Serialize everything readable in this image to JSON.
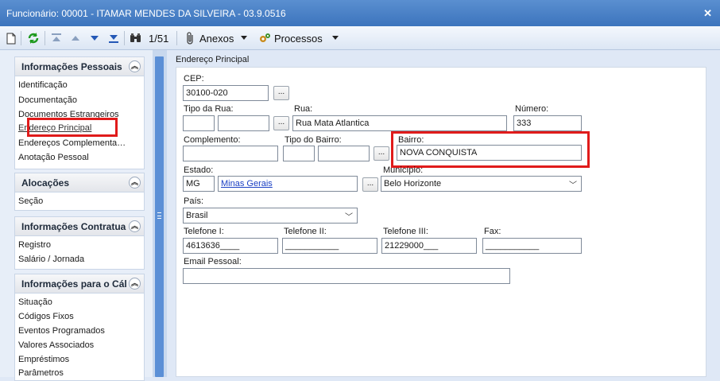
{
  "window": {
    "title": "Funcionário: 00001 - ITAMAR MENDES DA SILVEIRA - 03.9.0516",
    "close_glyph": "✕"
  },
  "toolbar": {
    "record_position": "1/51",
    "anexos_label": "Anexos",
    "processos_label": "Processos"
  },
  "sidebar": {
    "groups": [
      {
        "title": "Informações Pessoais",
        "items": [
          "Identificação",
          "Documentação",
          "Documentos Estrangeiros",
          "Endereço Principal",
          "Endereços Complementa…",
          "Anotação Pessoal"
        ]
      },
      {
        "title": "Alocações",
        "items": [
          "Seção"
        ]
      },
      {
        "title": "Informações Contratua",
        "items": [
          "Registro",
          "Salário / Jornada"
        ]
      },
      {
        "title": "Informações para o Cál",
        "items": [
          "Situação",
          "Códigos Fixos",
          "Eventos Programados",
          "Valores Associados",
          "Empréstimos",
          "Parâmetros"
        ]
      }
    ],
    "collapse_glyph": "︽"
  },
  "form": {
    "section_title": "Endereço Principal",
    "cep": {
      "label": "CEP:",
      "value": "30100-020"
    },
    "tipo_rua": {
      "label": "Tipo da Rua:",
      "code": "",
      "name": ""
    },
    "rua": {
      "label": "Rua:",
      "value": "Rua Mata Atlantica"
    },
    "numero": {
      "label": "Número:",
      "value": "333"
    },
    "complemento": {
      "label": "Complemento:",
      "value": ""
    },
    "tipo_bairro": {
      "label": "Tipo do Bairro:",
      "code": "",
      "name": ""
    },
    "bairro": {
      "label": "Bairro:",
      "value": "NOVA CONQUISTA"
    },
    "estado": {
      "label": "Estado:",
      "code": "MG",
      "name": "Minas Gerais"
    },
    "municipio": {
      "label": "Município:",
      "value": "Belo Horizonte"
    },
    "pais": {
      "label": "País:",
      "value": "Brasil"
    },
    "telefone1": {
      "label": "Telefone I:",
      "value": "4613636____"
    },
    "telefone2": {
      "label": "Telefone II:",
      "value": "___________"
    },
    "telefone3": {
      "label": "Telefone III:",
      "value": "21229000___"
    },
    "fax": {
      "label": "Fax:",
      "value": "___________"
    },
    "email": {
      "label": "Email Pessoal:",
      "value": ""
    },
    "lookup_glyph": "...",
    "dropdown_glyph": "﹀"
  },
  "colors": {
    "highlight": "#e01b1b",
    "titlebar": "#3c74bd",
    "scrollbar": "#5b8fd6"
  }
}
